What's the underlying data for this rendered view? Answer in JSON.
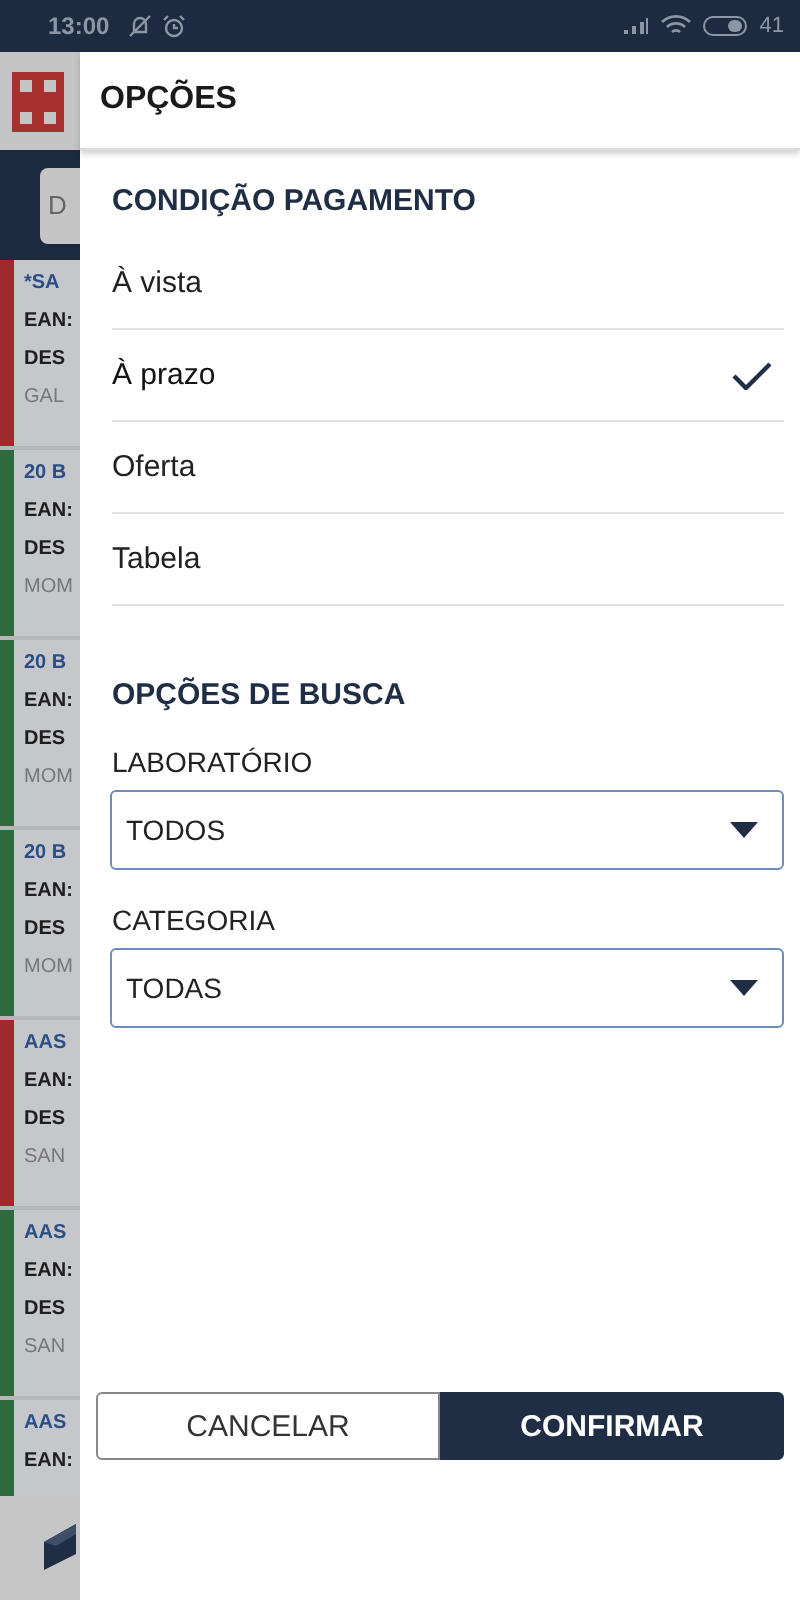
{
  "status_bar": {
    "time": "13:00",
    "battery": "41"
  },
  "background": {
    "search": {
      "placeholder": "D"
    },
    "cards": [
      {
        "color": "#9e2a2b",
        "title": "*SA",
        "ean": "EAN:",
        "desc": "DES",
        "lab": "GAL"
      },
      {
        "color": "#2e6a3c",
        "title": "20 B",
        "ean": "EAN:",
        "desc": "DES",
        "lab": "MOM"
      },
      {
        "color": "#2e6a3c",
        "title": "20 B",
        "ean": "EAN:",
        "desc": "DES",
        "lab": "MOM"
      },
      {
        "color": "#2e6a3c",
        "title": "20 B",
        "ean": "EAN:",
        "desc": "DES",
        "lab": "MOM"
      },
      {
        "color": "#9e2a2b",
        "title": "AAS",
        "ean": "EAN:",
        "desc": "DES",
        "lab": "SAN"
      },
      {
        "color": "#2e6a3c",
        "title": "AAS",
        "ean": "EAN:",
        "desc": "DES",
        "lab": "SAN"
      },
      {
        "color": "#2e6a3c",
        "title": "AAS",
        "ean": "EAN:"
      }
    ]
  },
  "panel": {
    "title": "OPÇÕES",
    "payment": {
      "heading": "CONDIÇÃO PAGAMENTO",
      "options": [
        {
          "label": "À vista",
          "selected": false
        },
        {
          "label": "À prazo",
          "selected": true
        },
        {
          "label": "Oferta",
          "selected": false
        },
        {
          "label": "Tabela",
          "selected": false
        }
      ]
    },
    "search_options": {
      "heading": "OPÇÕES DE BUSCA",
      "fields": [
        {
          "label": "LABORATÓRIO",
          "value": "TODOS"
        },
        {
          "label": "CATEGORIA",
          "value": "TODAS"
        }
      ]
    },
    "buttons": {
      "cancel": "CANCELAR",
      "confirm": "CONFIRMAR"
    }
  }
}
